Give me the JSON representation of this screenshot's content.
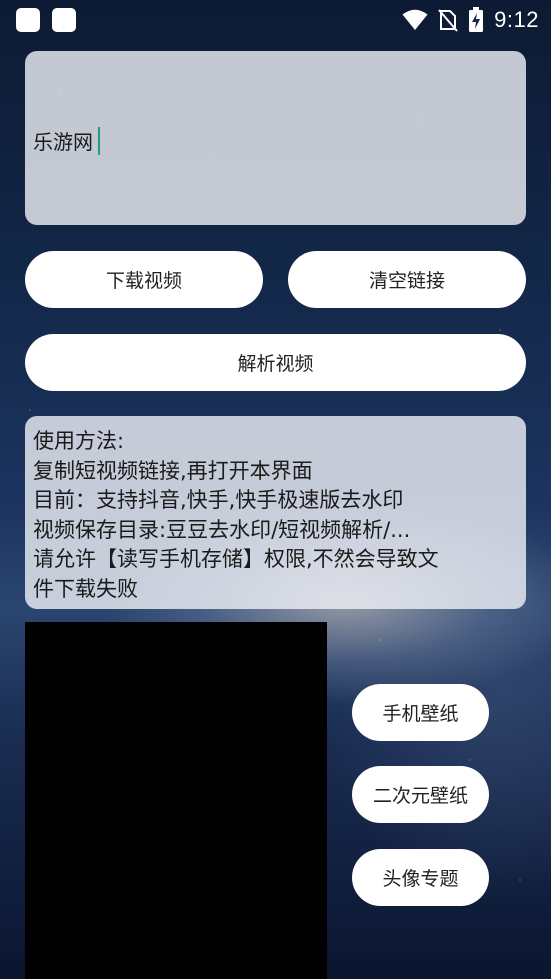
{
  "status_bar": {
    "time": "9:12",
    "icons": [
      "app-notification-icon",
      "app-notification-icon",
      "wifi-icon",
      "no-sim-icon",
      "battery-charging-icon"
    ]
  },
  "link_input": {
    "value": "乐游网"
  },
  "buttons": {
    "download": "下载视频",
    "clear": "清空链接",
    "parse": "解析视频",
    "wallpaper": "手机壁纸",
    "anime_wallpaper": "二次元壁纸",
    "avatar_topic": "头像专题"
  },
  "instructions": {
    "lines": [
      "使用方法:",
      "复制短视频链接,再打开本界面",
      "目前：支持抖音,快手,快手极速版去水印",
      "视频保存目录:豆豆去水印/短视频解析/...",
      "请允许【读写手机存储】权限,不然会导致文",
      "件下载失败"
    ]
  }
}
